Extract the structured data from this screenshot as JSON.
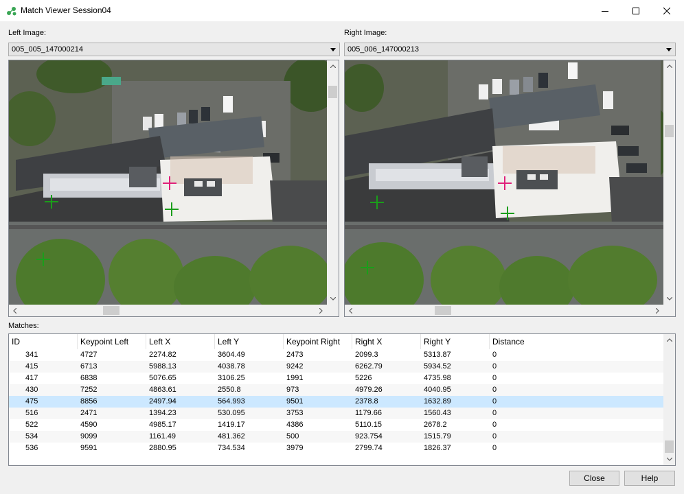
{
  "window": {
    "title": "Match Viewer Session04",
    "minimize_icon": "minimize-icon",
    "maximize_icon": "maximize-icon",
    "close_icon": "close-icon"
  },
  "left": {
    "label": "Left Image:",
    "selected": "005_005_147000214"
  },
  "right": {
    "label": "Right Image:",
    "selected": "005_006_147000213"
  },
  "matches": {
    "label": "Matches:",
    "columns": [
      "ID",
      "Keypoint Left",
      "Left X",
      "Left Y",
      "Keypoint Right",
      "Right X",
      "Right Y",
      "Distance"
    ],
    "rows": [
      [
        "341",
        "4727",
        "2274.82",
        "3604.49",
        "2473",
        "2099.3",
        "5313.87",
        "0"
      ],
      [
        "415",
        "6713",
        "5988.13",
        "4038.78",
        "9242",
        "6262.79",
        "5934.52",
        "0"
      ],
      [
        "417",
        "6838",
        "5076.65",
        "3106.25",
        "1991",
        "5226",
        "4735.98",
        "0"
      ],
      [
        "430",
        "7252",
        "4863.61",
        "2550.8",
        "973",
        "4979.26",
        "4040.95",
        "0"
      ],
      [
        "475",
        "8856",
        "2497.94",
        "564.993",
        "9501",
        "2378.8",
        "1632.89",
        "0"
      ],
      [
        "516",
        "2471",
        "1394.23",
        "530.095",
        "3753",
        "1179.66",
        "1560.43",
        "0"
      ],
      [
        "522",
        "4590",
        "4985.17",
        "1419.17",
        "4386",
        "5110.15",
        "2678.2",
        "0"
      ],
      [
        "534",
        "9099",
        "1161.49",
        "481.362",
        "500",
        "923.754",
        "1515.79",
        "0"
      ],
      [
        "536",
        "9591",
        "2880.95",
        "734.534",
        "3979",
        "2799.74",
        "1826.37",
        "0"
      ]
    ],
    "selected_id": "475"
  },
  "buttons": {
    "close": "Close",
    "help": "Help"
  },
  "colors": {
    "selection": "#cce8ff",
    "match_marker": "#1a9e1a",
    "selected_marker": "#e0207a"
  }
}
